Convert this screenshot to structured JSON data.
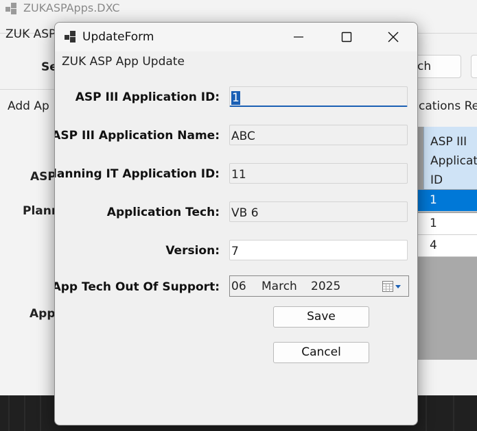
{
  "background_window": {
    "title": "ZUKASPApps.DXC",
    "menu_label": "ZUK ASP",
    "search_label": "Se",
    "search_button": "arch",
    "tab_add": "Add Ap",
    "tab_applications": "cations Re",
    "side_labels": [
      "ASP",
      "Plann",
      "App"
    ],
    "grid_header": "ASP III\nApplicat\nID",
    "grid_rows": [
      "1",
      "1",
      "4"
    ],
    "colors": {
      "selected_row": "#0078d7",
      "header_bg": "#cfe3f6"
    }
  },
  "dialog": {
    "title": "UpdateForm",
    "group_label": "ZUK ASP App Update",
    "fields": {
      "app_id": {
        "label": "ASP III Application ID:",
        "value": "1"
      },
      "app_name": {
        "label": "ASP III Application Name:",
        "value": "ABC"
      },
      "planning_id": {
        "label": "Planning IT Application ID:",
        "value": "11"
      },
      "tech": {
        "label": "Application Tech:",
        "value": "VB 6"
      },
      "version": {
        "label": "Version:",
        "value": "7"
      },
      "out_of_support": {
        "label": "App Tech Out Of Support:",
        "day": "06",
        "month": "March",
        "year": "2025"
      }
    },
    "buttons": {
      "save": "Save",
      "cancel": "Cancel"
    },
    "window_controls": [
      "minimize-icon",
      "maximize-icon",
      "close-icon"
    ]
  }
}
